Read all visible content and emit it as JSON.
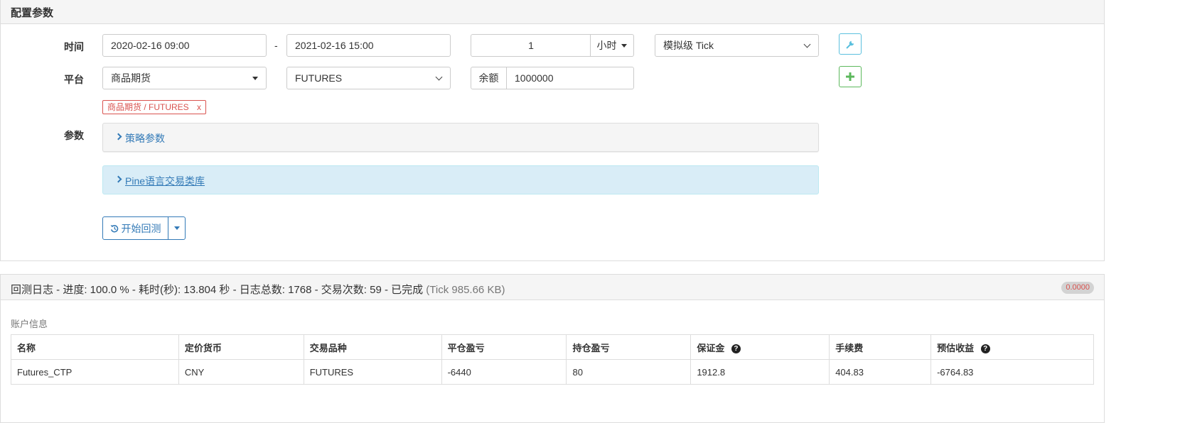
{
  "config": {
    "title": "配置参数",
    "time_label": "时间",
    "start_date": "2020-02-16 09:00",
    "date_separator": "-",
    "end_date": "2021-02-16 15:00",
    "period_value": "1",
    "period_unit": "小时",
    "tick_mode": "模拟级 Tick",
    "platform_label": "平台",
    "exchange": "商品期货",
    "contract": "FUTURES",
    "balance_label": "余额",
    "balance_value": "1000000",
    "tag_text": "商品期货 / FUTURES",
    "tag_close": "x",
    "params_label": "参数",
    "strategy_params": "策略参数",
    "pine_library": "Pine语言交易类库",
    "start_button": "开始回测",
    "accent_color": "#337ab7",
    "danger_color": "#d9534f",
    "success_color": "#5cb85c",
    "info_color": "#5bc0de"
  },
  "log": {
    "title": "回测日志 - 进度: 100.0 % - 耗时(秒): 13.804 秒 - 日志总数: 1768 - 交易次数: 59 - 已完成",
    "tick_info": "(Tick 985.66 KB)",
    "badge": "0.0000",
    "account_section": "账户信息",
    "help_glyph": "?",
    "columns": [
      "名称",
      "定价货币",
      "交易品种",
      "平仓盈亏",
      "持仓盈亏",
      "保证金",
      "手续费",
      "预估收益"
    ],
    "rows": [
      [
        "Futures_CTP",
        "CNY",
        "FUTURES",
        "-6440",
        "80",
        "1912.8",
        "404.83",
        "-6764.83"
      ]
    ]
  }
}
